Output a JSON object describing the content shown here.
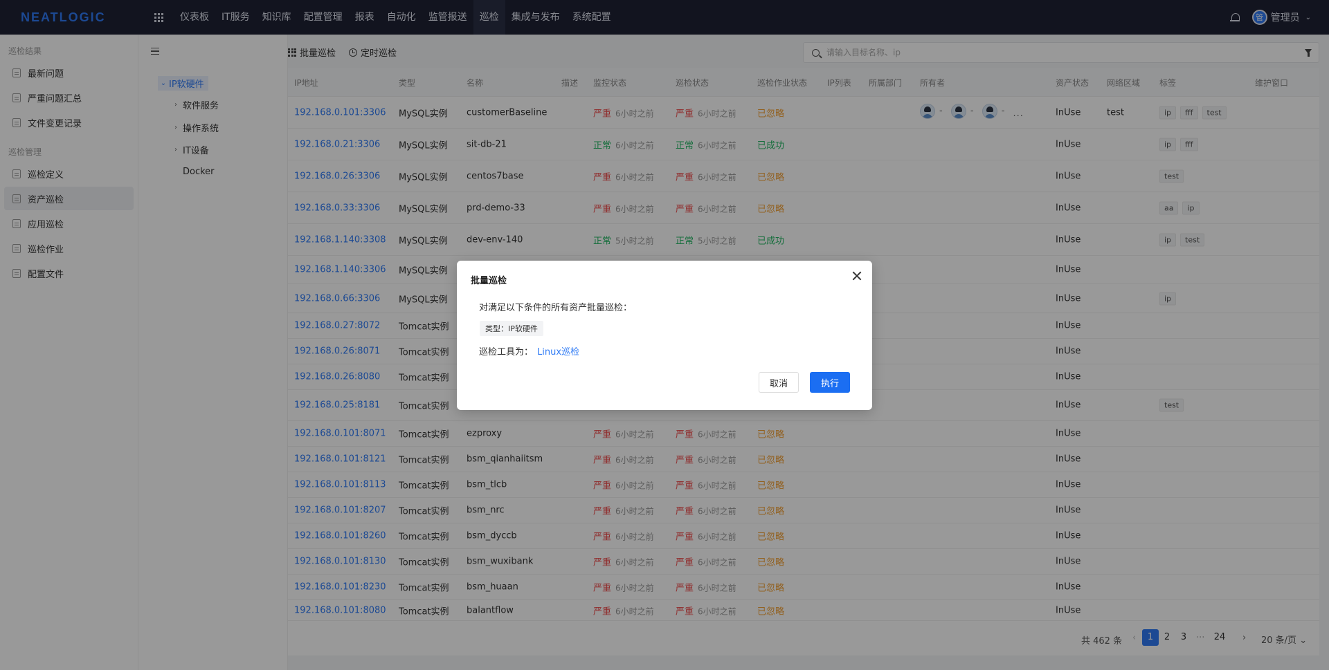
{
  "header": {
    "logo": "NEATLOGIC",
    "nav": [
      "仪表板",
      "IT服务",
      "知识库",
      "配置管理",
      "报表",
      "自动化",
      "监管报送",
      "巡检",
      "集成与发布",
      "系统配置"
    ],
    "active_nav": "巡检",
    "avatar_char": "管",
    "user": "管理员"
  },
  "sidebar": {
    "groups": [
      {
        "title": "巡检结果",
        "items": [
          "最新问题",
          "严重问题汇总",
          "文件变更记录"
        ]
      },
      {
        "title": "巡检管理",
        "items": [
          "巡检定义",
          "资产巡检",
          "应用巡检",
          "巡检作业",
          "配置文件"
        ]
      }
    ],
    "active_item": "资产巡检"
  },
  "tree": {
    "root": "IP软硬件",
    "children": [
      {
        "label": "软件服务",
        "expandable": true
      },
      {
        "label": "操作系统",
        "expandable": true
      },
      {
        "label": "IT设备",
        "expandable": true
      },
      {
        "label": "Docker",
        "expandable": false
      }
    ]
  },
  "toolbar": {
    "batch_label": "批量巡检",
    "timed_label": "定时巡检",
    "search_placeholder": "请输入目标名称、ip"
  },
  "table": {
    "columns": [
      "IP地址",
      "类型",
      "名称",
      "描述",
      "监控状态",
      "巡检状态",
      "巡检作业状态",
      "IP列表",
      "所属部门",
      "所有者",
      "资产状态",
      "网络区域",
      "标签",
      "维护窗口"
    ],
    "rows": [
      {
        "ip": "192.168.0.101:3306",
        "type": "MySQL实例",
        "name": "customerBaseline",
        "mon": "严重",
        "mon_time": "6小时之前",
        "insp": "严重",
        "insp_time": "6小时之前",
        "job": "已忽略",
        "owners": [
          "-",
          "-",
          "-"
        ],
        "more": "···",
        "asset": "InUse",
        "zone": "test",
        "tags": [
          "ip",
          "fff",
          "test"
        ]
      },
      {
        "ip": "192.168.0.21:3306",
        "type": "MySQL实例",
        "name": "sit-db-21",
        "mon": "正常",
        "mon_time": "6小时之前",
        "insp": "正常",
        "insp_time": "6小时之前",
        "job": "已成功",
        "asset": "InUse",
        "zone": "",
        "tags": [
          "ip",
          "fff"
        ]
      },
      {
        "ip": "192.168.0.26:3306",
        "type": "MySQL实例",
        "name": "centos7base",
        "mon": "严重",
        "mon_time": "6小时之前",
        "insp": "严重",
        "insp_time": "6小时之前",
        "job": "已忽略",
        "asset": "InUse",
        "zone": "",
        "tags": [
          "test"
        ]
      },
      {
        "ip": "192.168.0.33:3306",
        "type": "MySQL实例",
        "name": "prd-demo-33",
        "mon": "严重",
        "mon_time": "6小时之前",
        "insp": "严重",
        "insp_time": "6小时之前",
        "job": "已忽略",
        "asset": "InUse",
        "zone": "",
        "tags": [
          "aa",
          "ip"
        ]
      },
      {
        "ip": "192.168.1.140:3308",
        "type": "MySQL实例",
        "name": "dev-env-140",
        "mon": "正常",
        "mon_time": "5小时之前",
        "insp": "正常",
        "insp_time": "5小时之前",
        "job": "已成功",
        "asset": "InUse",
        "zone": "",
        "tags": [
          "ip",
          "test"
        ]
      },
      {
        "ip": "192.168.1.140:3306",
        "type": "MySQL实例",
        "asset": "InUse",
        "tags": []
      },
      {
        "ip": "192.168.0.66:3306",
        "type": "MySQL实例",
        "asset": "InUse",
        "tags": [
          "ip"
        ]
      },
      {
        "ip": "192.168.0.27:8072",
        "type": "Tomcat实例",
        "asset": "InUse",
        "tags": []
      },
      {
        "ip": "192.168.0.26:8071",
        "type": "Tomcat实例",
        "asset": "InUse",
        "tags": []
      },
      {
        "ip": "192.168.0.26:8080",
        "type": "Tomcat实例",
        "asset": "InUse",
        "tags": []
      },
      {
        "ip": "192.168.0.25:8181",
        "type": "Tomcat实例",
        "asset": "InUse",
        "tags": [
          "test"
        ]
      },
      {
        "ip": "192.168.0.101:8071",
        "type": "Tomcat实例",
        "name": "ezproxy",
        "mon": "严重",
        "mon_time": "6小时之前",
        "insp": "严重",
        "insp_time": "6小时之前",
        "job": "已忽略",
        "asset": "InUse",
        "tags": []
      },
      {
        "ip": "192.168.0.101:8121",
        "type": "Tomcat实例",
        "name": "bsm_qianhaiitsm",
        "mon": "严重",
        "mon_time": "6小时之前",
        "insp": "严重",
        "insp_time": "6小时之前",
        "job": "已忽略",
        "asset": "InUse",
        "tags": []
      },
      {
        "ip": "192.168.0.101:8113",
        "type": "Tomcat实例",
        "name": "bsm_tlcb",
        "mon": "严重",
        "mon_time": "6小时之前",
        "insp": "严重",
        "insp_time": "6小时之前",
        "job": "已忽略",
        "asset": "InUse",
        "tags": []
      },
      {
        "ip": "192.168.0.101:8207",
        "type": "Tomcat实例",
        "name": "bsm_nrc",
        "mon": "严重",
        "mon_time": "6小时之前",
        "insp": "严重",
        "insp_time": "6小时之前",
        "job": "已忽略",
        "asset": "InUse",
        "tags": []
      },
      {
        "ip": "192.168.0.101:8260",
        "type": "Tomcat实例",
        "name": "bsm_dyccb",
        "mon": "严重",
        "mon_time": "6小时之前",
        "insp": "严重",
        "insp_time": "6小时之前",
        "job": "已忽略",
        "asset": "InUse",
        "tags": []
      },
      {
        "ip": "192.168.0.101:8130",
        "type": "Tomcat实例",
        "name": "bsm_wuxibank",
        "mon": "严重",
        "mon_time": "6小时之前",
        "insp": "严重",
        "insp_time": "6小时之前",
        "job": "已忽略",
        "asset": "InUse",
        "tags": []
      },
      {
        "ip": "192.168.0.101:8230",
        "type": "Tomcat实例",
        "name": "bsm_huaan",
        "mon": "严重",
        "mon_time": "6小时之前",
        "insp": "严重",
        "insp_time": "6小时之前",
        "job": "已忽略",
        "asset": "InUse",
        "tags": []
      },
      {
        "ip": "192.168.0.101:8080",
        "type": "Tomcat实例",
        "name": "balantflow",
        "mon": "严重",
        "mon_time": "6小时之前",
        "insp": "严重",
        "insp_time": "6小时之前",
        "job": "已忽略",
        "asset": "InUse",
        "tags": []
      }
    ]
  },
  "pagination": {
    "total": "共 462 条",
    "pages": [
      "1",
      "2",
      "3"
    ],
    "ellipsis": "···",
    "last": "24",
    "current": "1",
    "page_size": "20 条/页"
  },
  "modal": {
    "title": "批量巡检",
    "desc": "对满足以下条件的所有资产批量巡检：",
    "condition": "类型：IP软硬件",
    "tool_label": "巡检工具为：",
    "tool_value": "Linux巡检",
    "cancel": "取消",
    "execute": "执行"
  },
  "colors": {
    "accent": "#2f7bf5",
    "danger": "#f04b4b",
    "success": "#25b865",
    "warning": "#f4a236",
    "nav_bg": "#1f2235"
  }
}
